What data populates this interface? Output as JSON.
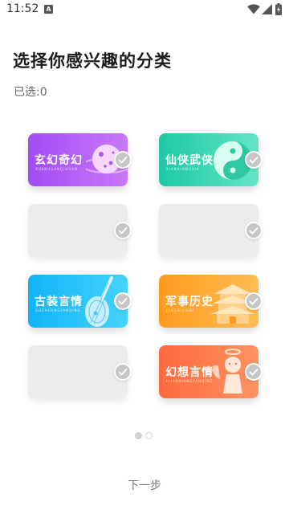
{
  "status_bar": {
    "time": "11:52",
    "notification_letter": "A"
  },
  "header": {
    "title": "选择你感兴趣的分类",
    "selected_text": "已选:0"
  },
  "categories": [
    {
      "label": "玄幻奇幻",
      "pinyin": "XUANHUANQIHUAN",
      "color_start": "#a24cf3",
      "color_end": "#c779f7",
      "state": "unselected"
    },
    {
      "label": "仙侠武侠",
      "pinyin": "XIANXIAWUXIA",
      "color_start": "#1ec9a4",
      "color_end": "#63e5c5",
      "state": "unselected"
    },
    {
      "label": "",
      "pinyin": "",
      "state": "placeholder"
    },
    {
      "label": "",
      "pinyin": "",
      "state": "placeholder"
    },
    {
      "label": "古装言情",
      "pinyin": "GUZHUANGYANQING",
      "color_start": "#11b3f6",
      "color_end": "#43d4fb",
      "state": "unselected"
    },
    {
      "label": "军事历史",
      "pinyin": "JUNSHILISHI",
      "color_start": "#ff9a1f",
      "color_end": "#ffbd52",
      "state": "unselected"
    },
    {
      "label": "",
      "pinyin": "",
      "state": "placeholder"
    },
    {
      "label": "幻想言情",
      "pinyin": "HUANXIANGYANQING",
      "color_start": "#ff6a3d",
      "color_end": "#ff9262",
      "state": "unselected"
    }
  ],
  "pager": {
    "pages": 2,
    "current": 1
  },
  "footer": {
    "next_label": "下一步"
  },
  "colors": {
    "check_gray": "#c7c7c7",
    "placeholder_gray": "#ececec"
  }
}
